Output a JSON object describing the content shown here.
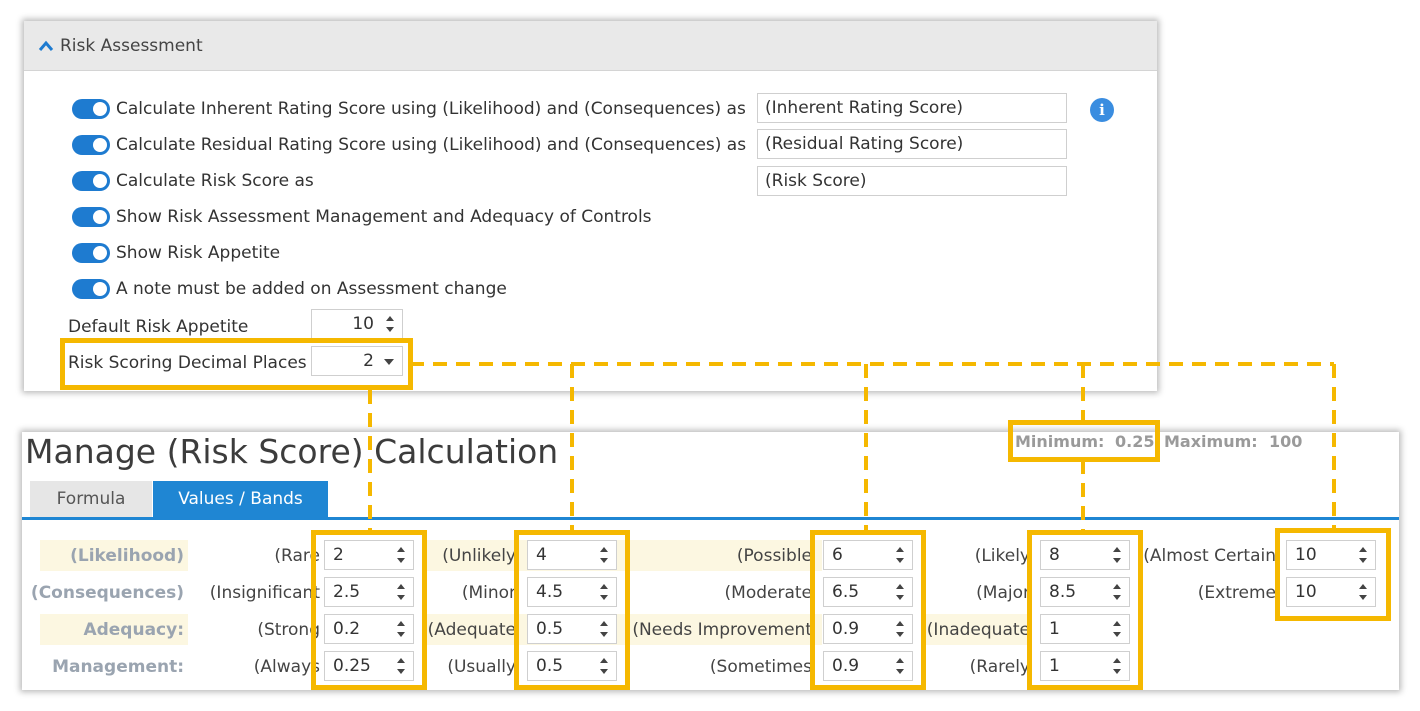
{
  "risk_assessment": {
    "header": "Risk Assessment",
    "options": [
      {
        "label": "Calculate Inherent Rating Score using (Likelihood) and (Consequences) as",
        "value": "(Inherent Rating Score)"
      },
      {
        "label": "Calculate Residual Rating Score using (Likelihood) and (Consequences) as",
        "value": "(Residual Rating Score)"
      },
      {
        "label": "Calculate Risk Score as",
        "value": "(Risk Score)"
      },
      {
        "label": "Show Risk Assessment Management and Adequacy of Controls"
      },
      {
        "label": "Show Risk Appetite"
      },
      {
        "label": "A note must be added on Assessment change"
      }
    ],
    "default_appetite_label": "Default Risk Appetite",
    "default_appetite_value": "10",
    "decimal_places_label": "Risk Scoring Decimal Places",
    "decimal_places_value": "2"
  },
  "calculation": {
    "title": "Manage (Risk Score) Calculation",
    "minimum_label": "Minimum:",
    "minimum_value": "0.25",
    "maximum_label": "Maximum:",
    "maximum_value": "100",
    "tabs": [
      "Formula",
      "Values / Bands"
    ],
    "active_tab": "Values / Bands",
    "rows": [
      {
        "label": "(Likelihood)",
        "cells": [
          {
            "label": "(Rare",
            "value": "2"
          },
          {
            "label": "(Unlikely",
            "value": "4"
          },
          {
            "label": "(Possible",
            "value": "6"
          },
          {
            "label": "(Likely",
            "value": "8"
          },
          {
            "label": "(Almost Certain",
            "value": "10"
          }
        ]
      },
      {
        "label": "(Consequences)",
        "cells": [
          {
            "label": "(Insignificant",
            "value": "2.5"
          },
          {
            "label": "(Minor",
            "value": "4.5"
          },
          {
            "label": "(Moderate",
            "value": "6.5"
          },
          {
            "label": "(Major",
            "value": "8.5"
          },
          {
            "label": "(Extreme",
            "value": "10"
          }
        ]
      },
      {
        "label": "Adequacy:",
        "cells": [
          {
            "label": "(Strong",
            "value": "0.2"
          },
          {
            "label": "(Adequate",
            "value": "0.5"
          },
          {
            "label": "(Needs Improvement",
            "value": "0.9"
          },
          {
            "label": "(Inadequate",
            "value": "1"
          }
        ]
      },
      {
        "label": "Management:",
        "cells": [
          {
            "label": "(Always",
            "value": "0.25"
          },
          {
            "label": "(Usually",
            "value": "0.5"
          },
          {
            "label": "(Sometimes",
            "value": "0.9"
          },
          {
            "label": "(Rarely",
            "value": "1"
          }
        ]
      }
    ]
  },
  "colors": {
    "toggle": "#1e7bd0",
    "tab_active": "#1f86d3",
    "highlight": "#f5b800",
    "label_band": "#fcf7e1"
  }
}
